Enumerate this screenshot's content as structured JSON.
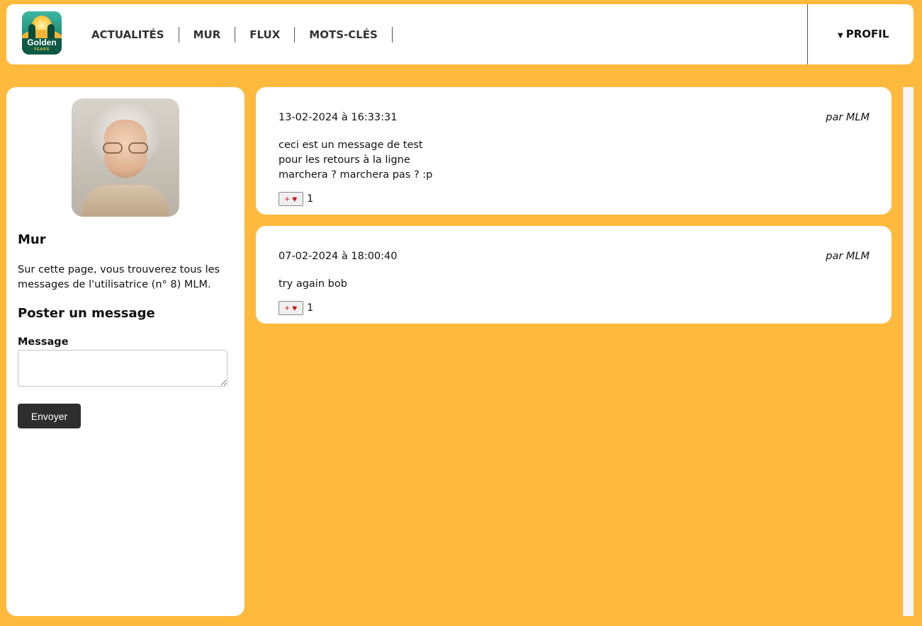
{
  "header": {
    "logo_word": "Golden",
    "logo_sub": "YEARS",
    "nav": [
      {
        "label": "ACTUALITÉS"
      },
      {
        "label": "MUR"
      },
      {
        "label": "FLUX"
      },
      {
        "label": "MOTS-CLÉS"
      }
    ],
    "profile_label": "PROFIL"
  },
  "sidebar": {
    "title": "Mur",
    "description": "Sur cette page, vous trouverez tous les messages de l'utilisatrice (n° 8) MLM.",
    "post_title": "Poster un message",
    "message_label": "Message",
    "message_value": "",
    "send_label": "Envoyer"
  },
  "posts": [
    {
      "date": "13-02-2024 à 16:33:31",
      "author": "par MLM",
      "body": "ceci est un message de test\npour les retours à la ligne\nmarchera ? marchera pas ? :p",
      "like_label": "+ ♥",
      "likes": "1"
    },
    {
      "date": "07-02-2024 à 18:00:40",
      "author": "par MLM",
      "body": "try again bob",
      "like_label": "+ ♥",
      "likes": "1"
    }
  ],
  "colors": {
    "background": "#ffb93d",
    "card": "#ffffff",
    "button_dark": "#2e2e2e",
    "heart": "#dd1111"
  }
}
